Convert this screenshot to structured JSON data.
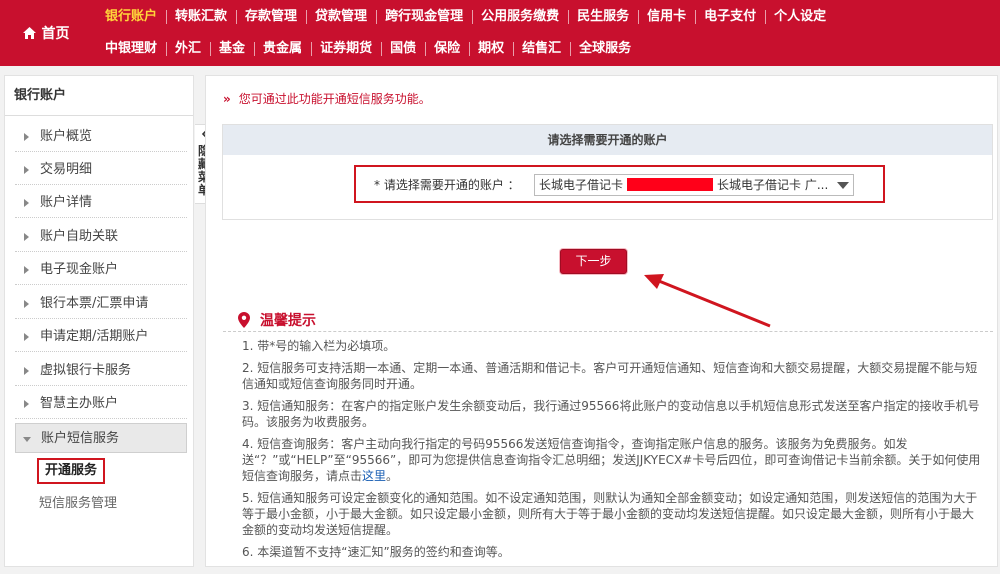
{
  "nav": {
    "home": "首页",
    "row1": [
      "银行账户",
      "转账汇款",
      "存款管理",
      "贷款管理",
      "跨行现金管理",
      "公用服务缴费",
      "民生服务",
      "信用卡",
      "电子支付",
      "个人设定"
    ],
    "row2": [
      "中银理财",
      "外汇",
      "基金",
      "贵金属",
      "证券期货",
      "国债",
      "保险",
      "期权",
      "结售汇",
      "全球服务"
    ],
    "active": "银行账户"
  },
  "sidebar": {
    "title": "银行账户",
    "items": [
      "账户概览",
      "交易明细",
      "账户详情",
      "账户自助关联",
      "电子现金账户",
      "银行本票/汇票申请",
      "申请定期/活期账户",
      "虚拟银行卡服务",
      "智慧主办账户",
      "账户短信服务"
    ],
    "sub_items": [
      "开通服务",
      "短信服务管理"
    ],
    "hide_tab": "隐藏菜单"
  },
  "main": {
    "notice": "您可通过此功能开通短信服务功能。",
    "panel_title": "请选择需要开通的账户",
    "select_label": "* 请选择需要开通的账户 ：",
    "select_value_prefix": "长城电子借记卡",
    "select_value_suffix": "长城电子借记卡 广...",
    "next_button": "下一步",
    "tips_title": "温馨提示",
    "tips": [
      "1. 带*号的输入栏为必填项。",
      "2. 短信服务可支持活期一本通、定期一本通、普通活期和借记卡。客户可开通短信通知、短信查询和大额交易提醒，大额交易提醒不能与短信通知或短信查询服务同时开通。",
      "3. 短信通知服务：在客户的指定账户发生余额变动后，我行通过95566将此账户的变动信息以手机短信息形式发送至客户指定的接收手机号码。该服务为收费服务。",
      "4. 短信查询服务：客户主动向我行指定的号码95566发送短信查询指令，查询指定账户信息的服务。该服务为免费服务。如发送“？”或“HELP”至“95566”，即可为您提供信息查询指令汇总明细；发送JJKYECX#卡号后四位，即可查询借记卡当前余额。关于如何使用短信查询服务，请点击",
      "5. 短信通知服务可设定金额变化的通知范围。如不设定通知范围，则默认为通知全部金额变动；如设定通知范围，则发送短信的范围为大于等于最小金额，小于最大金额。如只设定最小金额，则所有大于等于最小金额的变动均发送短信提醒。如只设定最大金额，则所有小于最大金额的变动均发送短信提醒。",
      "6. 本渠道暂不支持“速汇知”服务的签约和查询等。"
    ],
    "tips_link": "这里",
    "tips_link_tail": "。"
  },
  "colors": {
    "brand": "#c8102e",
    "active_nav": "#ffd43a",
    "highlight_box": "#d0151f"
  }
}
